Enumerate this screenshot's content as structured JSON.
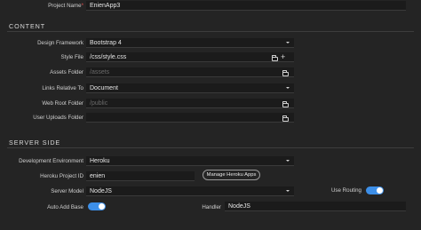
{
  "project": {
    "label": "Project Name",
    "required_mark": "*",
    "value": "EnienApp3"
  },
  "content": {
    "heading": "CONTENT",
    "design_framework": {
      "label": "Design Framework",
      "value": "Bootstrap 4"
    },
    "style_file": {
      "label": "Style File",
      "value": "/css/style.css"
    },
    "assets_folder": {
      "label": "Assets Folder",
      "placeholder": "/assets"
    },
    "links_relative_to": {
      "label": "Links Relative To",
      "value": "Document"
    },
    "web_root_folder": {
      "label": "Web Root Folder",
      "placeholder": "/public"
    },
    "user_uploads_folder": {
      "label": "User Uploads Folder",
      "value": ""
    }
  },
  "server_side": {
    "heading": "SERVER SIDE",
    "development_environment": {
      "label": "Development Environment",
      "value": "Heroku"
    },
    "heroku_project_id": {
      "label": "Heroku Project ID",
      "value": "enien"
    },
    "manage_button": "Manage Heroku Apps",
    "server_model": {
      "label": "Server Model",
      "value": "NodeJS"
    },
    "use_routing": {
      "label": "Use Routing",
      "on": true
    },
    "auto_add_base": {
      "label": "Auto Add Base",
      "on": true
    },
    "handler": {
      "label": "Handler",
      "value": "NodeJS"
    }
  },
  "icons": [
    "folder-icon",
    "plus-icon",
    "chevron-down-icon"
  ],
  "colors": {
    "background": "#242424",
    "field": "#1b1b1b",
    "accent": "#3d8fe8"
  }
}
